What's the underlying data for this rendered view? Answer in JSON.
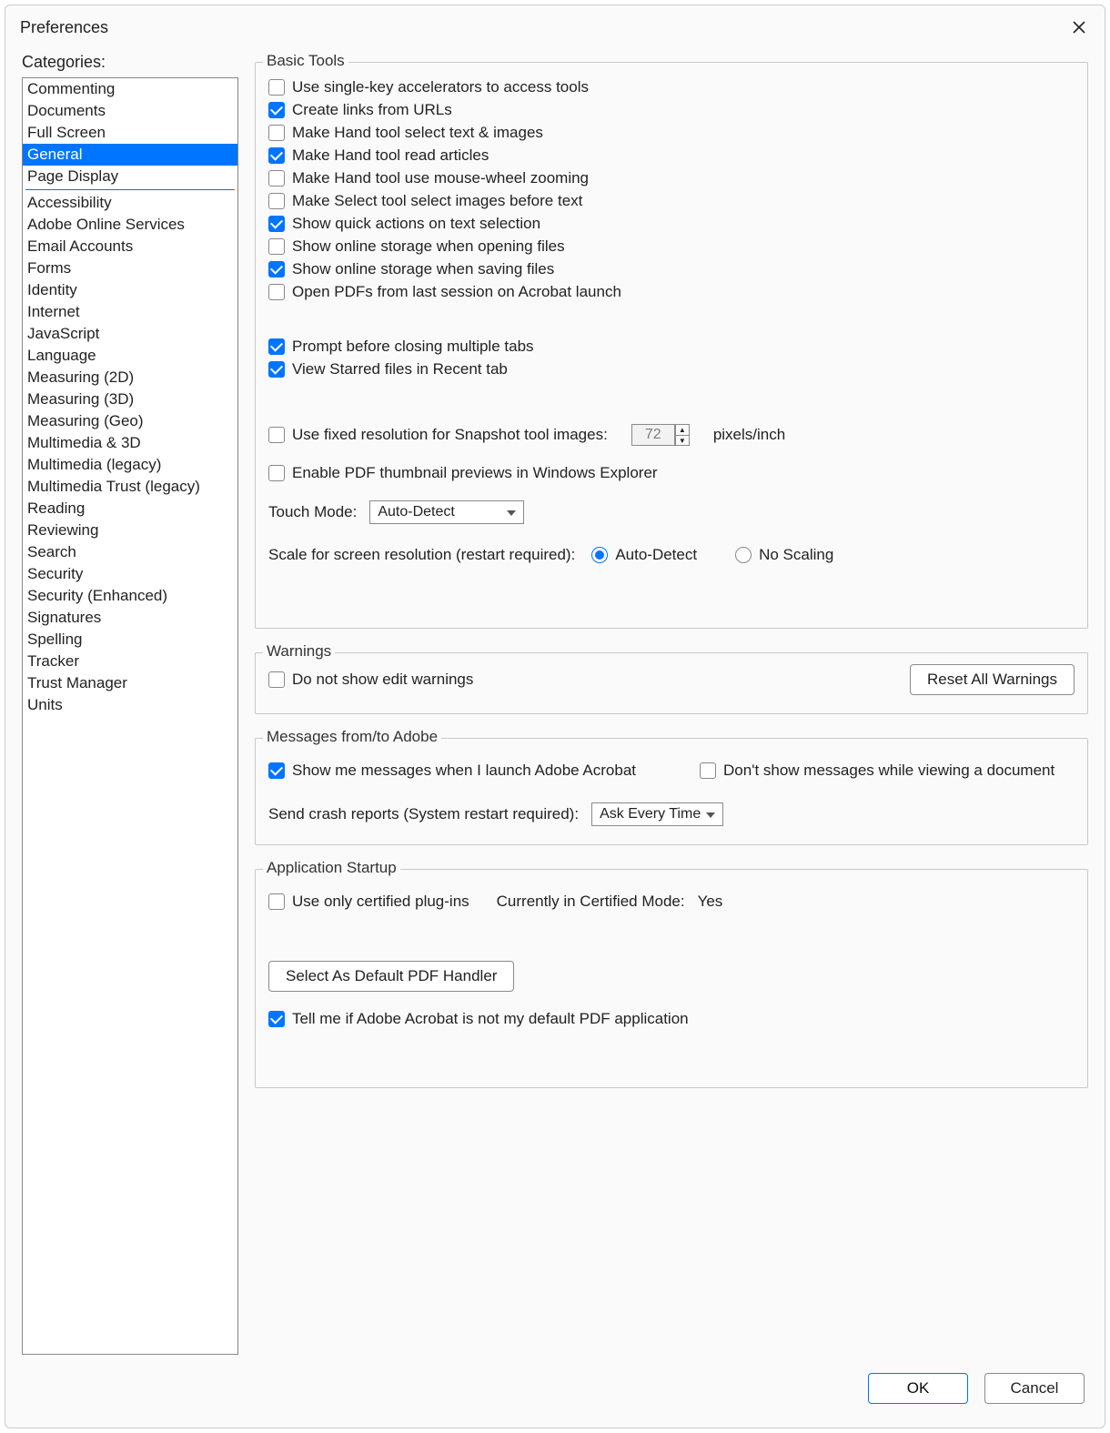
{
  "window": {
    "title": "Preferences"
  },
  "sidebar": {
    "label": "Categories:",
    "group1": [
      "Commenting",
      "Documents",
      "Full Screen",
      "General",
      "Page Display"
    ],
    "selected": "General",
    "group2": [
      "Accessibility",
      "Adobe Online Services",
      "Email Accounts",
      "Forms",
      "Identity",
      "Internet",
      "JavaScript",
      "Language",
      "Measuring (2D)",
      "Measuring (3D)",
      "Measuring (Geo)",
      "Multimedia & 3D",
      "Multimedia (legacy)",
      "Multimedia Trust (legacy)",
      "Reading",
      "Reviewing",
      "Search",
      "Security",
      "Security (Enhanced)",
      "Signatures",
      "Spelling",
      "Tracker",
      "Trust Manager",
      "Units"
    ]
  },
  "basic": {
    "legend": "Basic Tools",
    "items": [
      {
        "label": "Use single-key accelerators to access tools",
        "checked": false
      },
      {
        "label": "Create links from URLs",
        "checked": true
      },
      {
        "label": "Make Hand tool select text & images",
        "checked": false
      },
      {
        "label": "Make Hand tool read articles",
        "checked": true
      },
      {
        "label": "Make Hand tool use mouse-wheel zooming",
        "checked": false
      },
      {
        "label": "Make Select tool select images before text",
        "checked": false
      },
      {
        "label": "Show quick actions on text selection",
        "checked": true
      },
      {
        "label": "Show online storage when opening files",
        "checked": false
      },
      {
        "label": "Show online storage when saving files",
        "checked": true
      },
      {
        "label": "Open PDFs from last session on Acrobat launch",
        "checked": false
      }
    ],
    "items2": [
      {
        "label": "Prompt before closing multiple tabs",
        "checked": true
      },
      {
        "label": "View Starred files in Recent tab",
        "checked": true
      }
    ],
    "snapshot": {
      "label": "Use fixed resolution for Snapshot tool images:",
      "checked": false,
      "value": "72",
      "unit": "pixels/inch"
    },
    "thumb": {
      "label": "Enable PDF thumbnail previews in Windows Explorer",
      "checked": false
    },
    "touch": {
      "label": "Touch Mode:",
      "value": "Auto-Detect"
    },
    "scale": {
      "label": "Scale for screen resolution (restart required):",
      "opt1": "Auto-Detect",
      "opt2": "No Scaling",
      "selected": "Auto-Detect"
    }
  },
  "warnings": {
    "legend": "Warnings",
    "item": {
      "label": "Do not show edit warnings",
      "checked": false
    },
    "button": "Reset All Warnings"
  },
  "messages": {
    "legend": "Messages from/to Adobe",
    "item1": {
      "label": "Show me messages when I launch Adobe Acrobat",
      "checked": true
    },
    "item2": {
      "label": "Don't show messages while viewing a document",
      "checked": false
    },
    "crash": {
      "label": "Send crash reports (System restart required):",
      "value": "Ask Every Time"
    }
  },
  "startup": {
    "legend": "Application Startup",
    "item1": {
      "label": "Use only certified plug-ins",
      "checked": false
    },
    "cert": {
      "label": "Currently in Certified Mode:",
      "value": "Yes"
    },
    "button": "Select As Default PDF Handler",
    "item2": {
      "label": "Tell me if Adobe Acrobat is not my default PDF application",
      "checked": true
    }
  },
  "footer": {
    "ok": "OK",
    "cancel": "Cancel"
  }
}
